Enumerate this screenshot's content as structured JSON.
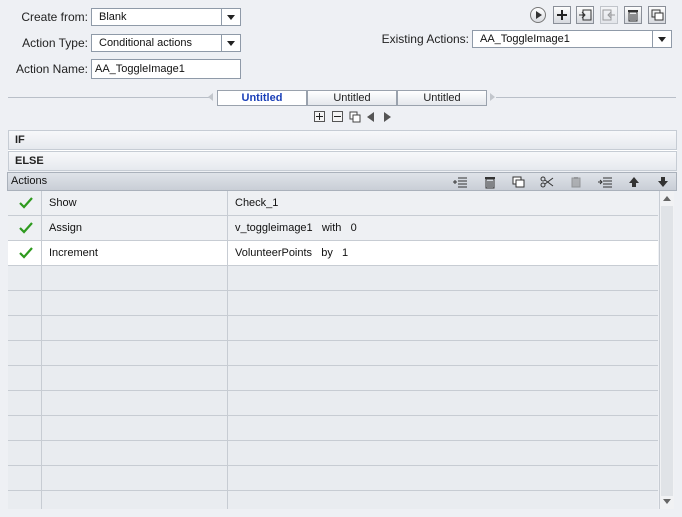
{
  "form": {
    "create_from_label": "Create from:",
    "create_from_value": "Blank",
    "action_type_label": "Action Type:",
    "action_type_value": "Conditional actions",
    "action_name_label": "Action Name:",
    "action_name_value": "AA_ToggleImage1",
    "existing_actions_label": "Existing Actions:",
    "existing_actions_value": "AA_ToggleImage1"
  },
  "toolbar": {
    "icons": [
      "play-icon",
      "add-icon",
      "import-icon",
      "export-icon",
      "trash-icon",
      "duplicate-icon"
    ]
  },
  "tabs": [
    {
      "label": "Untitled",
      "active": true
    },
    {
      "label": "Untitled",
      "active": false
    },
    {
      "label": "Untitled",
      "active": false
    }
  ],
  "sections": {
    "if_label": "IF",
    "else_label": "ELSE",
    "actions_label": "Actions"
  },
  "actions_table": {
    "rows": [
      {
        "action": "Show",
        "detail": "Check_1",
        "checked": true
      },
      {
        "action": "Assign",
        "detail": "v_toggleimage1   with   0",
        "checked": true
      },
      {
        "action": "Increment",
        "detail": "VolunteerPoints   by   1",
        "checked": true
      }
    ],
    "selected_row": 2
  },
  "colors": {
    "accent_tab": "#1a3fb8",
    "check_green": "#2e9a1e",
    "background": "#eef0f4"
  }
}
